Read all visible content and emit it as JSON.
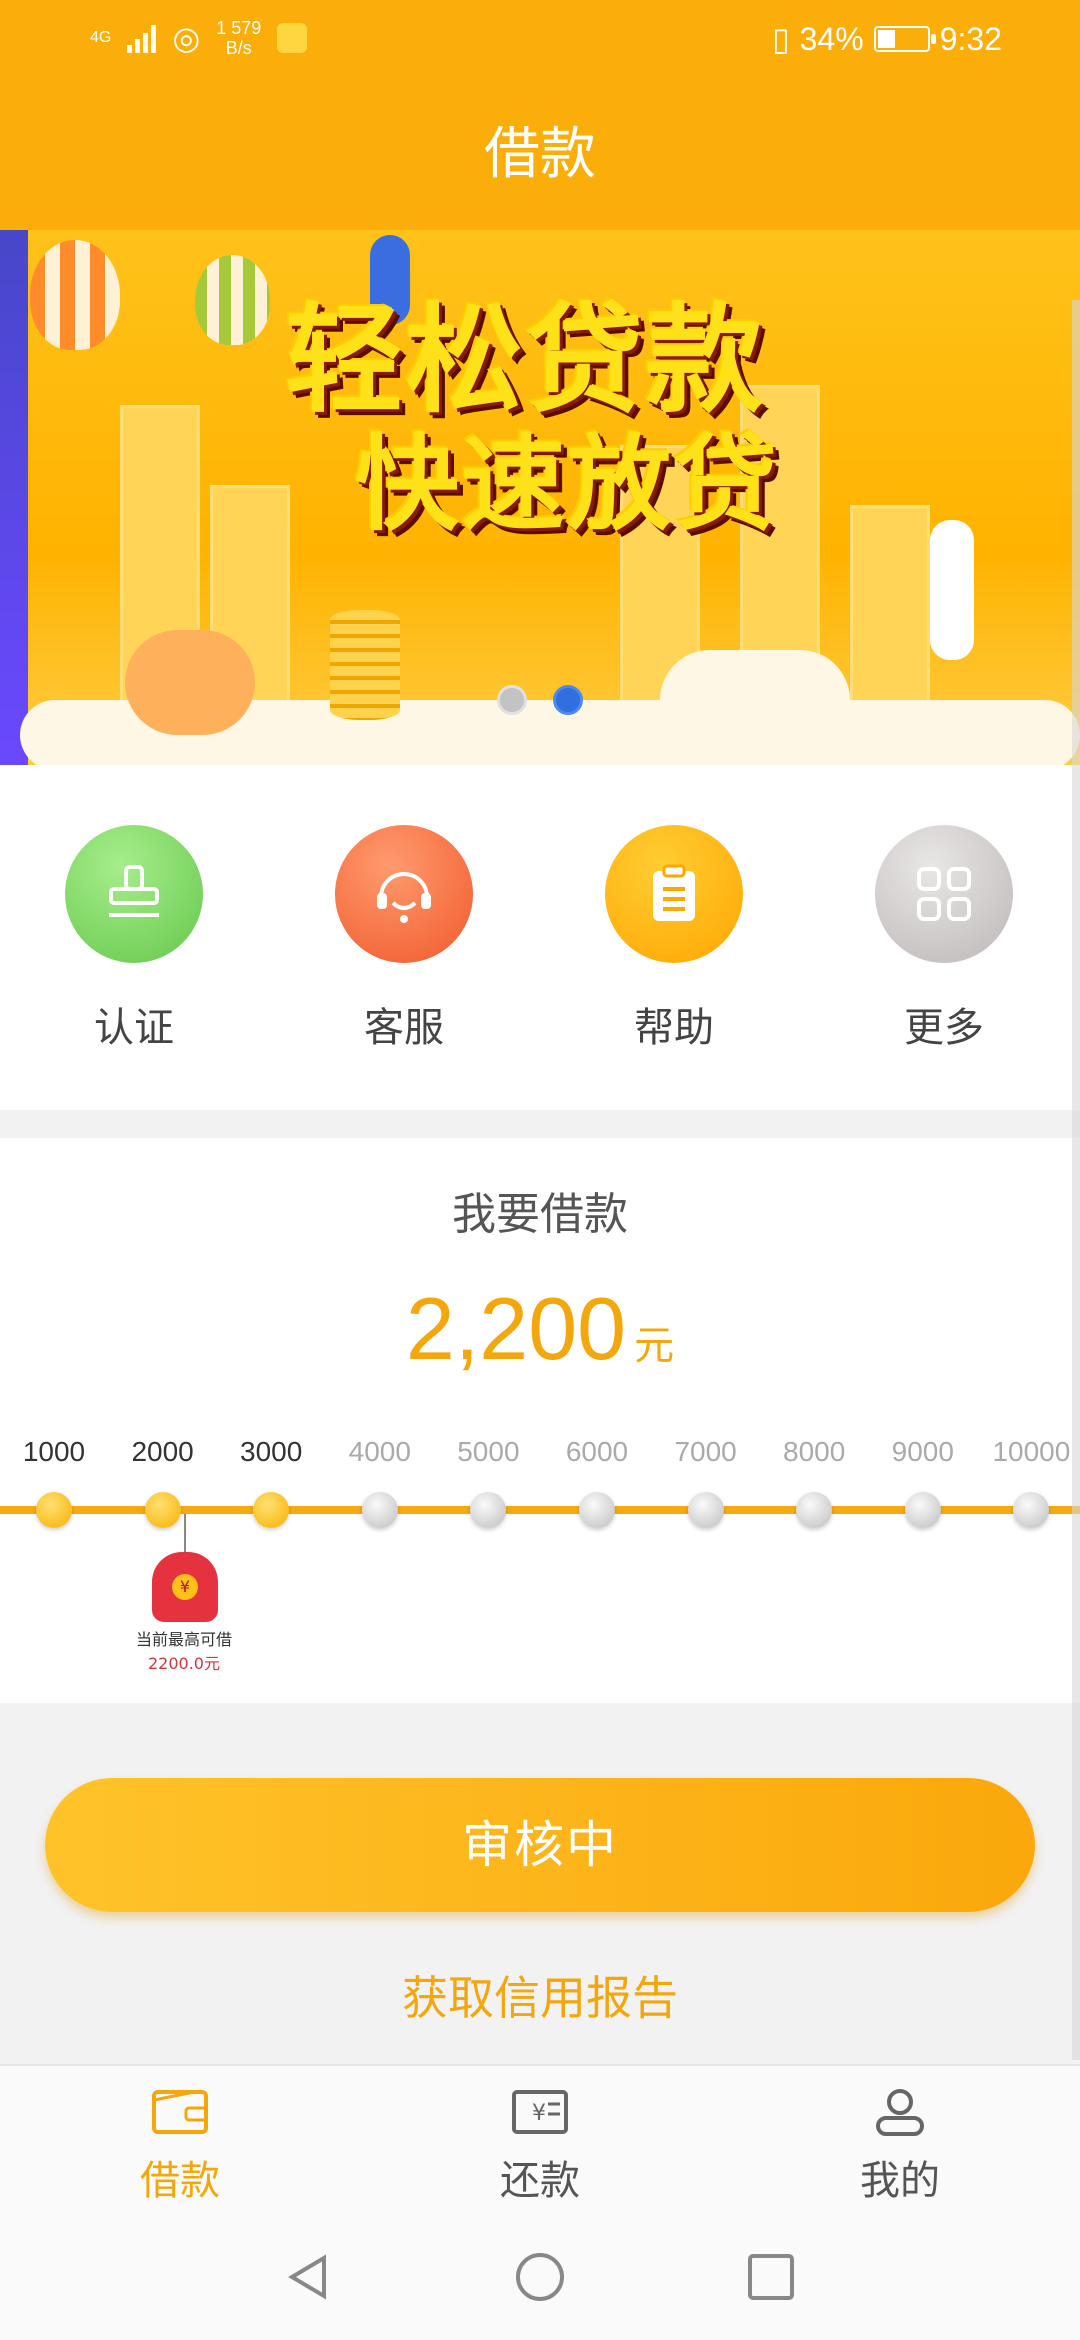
{
  "status_bar": {
    "network": "4G",
    "speed_value": "1 579",
    "speed_unit": "B/s",
    "battery": "34%",
    "time": "9:32"
  },
  "header": {
    "title": "借款"
  },
  "banner": {
    "line1": "轻松贷款",
    "line2": "快速放贷",
    "active_slide": 2,
    "slide_count": 2
  },
  "quick_actions": [
    {
      "label": "认证",
      "icon": "stamp-icon",
      "color": "#66c74c"
    },
    {
      "label": "客服",
      "icon": "headset-icon",
      "color": "#f05a2c"
    },
    {
      "label": "帮助",
      "icon": "clipboard-icon",
      "color": "#ffa600"
    },
    {
      "label": "更多",
      "icon": "grid-icon",
      "color": "#bdb7b7"
    }
  ],
  "loan": {
    "title": "我要借款",
    "amount": "2,200",
    "unit": "元",
    "ticks": [
      "1000",
      "2000",
      "3000",
      "4000",
      "5000",
      "6000",
      "7000",
      "8000",
      "9000",
      "10000"
    ],
    "active_ticks": 3,
    "max_label": "当前最高可借",
    "max_value": "2200.0元"
  },
  "actions": {
    "primary": "审核中",
    "credit_link": "获取信用报告"
  },
  "bottom_nav": [
    {
      "label": "借款",
      "icon": "wallet-icon",
      "active": true
    },
    {
      "label": "还款",
      "icon": "bill-icon",
      "active": false
    },
    {
      "label": "我的",
      "icon": "user-icon",
      "active": false
    }
  ],
  "colors": {
    "brand": "#fbad0a",
    "accent": "#f3a70c",
    "dot_active": "#2f6fe0"
  }
}
